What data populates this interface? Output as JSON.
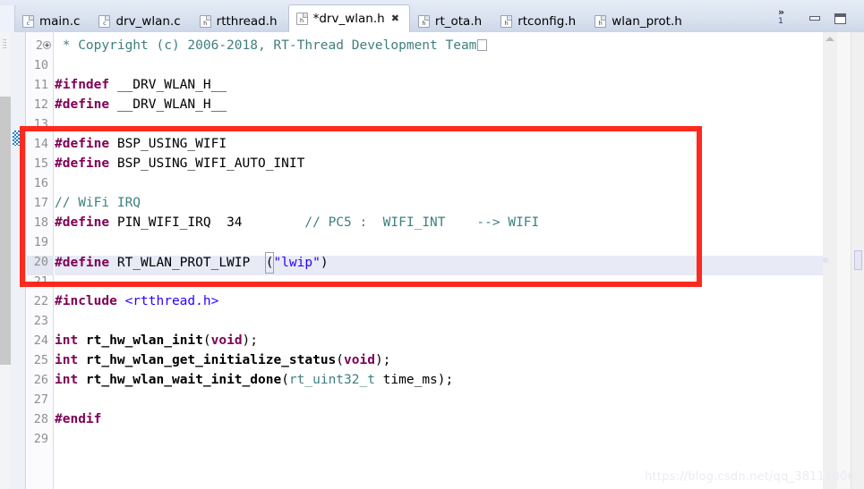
{
  "window": {
    "minimize_label": "Minimize",
    "maximize_label": "Maximize",
    "overflow_chevron": "»",
    "overflow_count": "1"
  },
  "tabs": [
    {
      "label": "main.c",
      "ext": "c",
      "active": false,
      "dirty": false
    },
    {
      "label": "drv_wlan.c",
      "ext": "c",
      "active": false,
      "dirty": false
    },
    {
      "label": "rtthread.h",
      "ext": "h",
      "active": false,
      "dirty": false
    },
    {
      "label": "*drv_wlan.h",
      "ext": "h",
      "active": true,
      "dirty": true,
      "close_glyph": "✖"
    },
    {
      "label": "rt_ota.h",
      "ext": "h",
      "active": false,
      "dirty": false
    },
    {
      "label": "rtconfig.h",
      "ext": "h",
      "active": false,
      "dirty": false
    },
    {
      "label": "wlan_prot.h",
      "ext": "h",
      "active": false,
      "dirty": false
    }
  ],
  "editor": {
    "filename": "drv_wlan.h",
    "current_line": 20,
    "changed_line": 14,
    "folded_line": 2,
    "lines": [
      {
        "num": "2",
        "text": " * Copyright (c) 2006-2018, RT-Thread Development Team",
        "kind": "comment",
        "folded": true
      },
      {
        "num": "10",
        "text": "",
        "kind": "blank"
      },
      {
        "num": "11",
        "text": "#ifndef __DRV_WLAN_H__",
        "kind": "ifndef"
      },
      {
        "num": "12",
        "text": "#define __DRV_WLAN_H__",
        "kind": "define_plain"
      },
      {
        "num": "13",
        "text": "",
        "kind": "blank"
      },
      {
        "num": "14",
        "text": "#define BSP_USING_WIFI",
        "kind": "define_plain"
      },
      {
        "num": "15",
        "text": "#define BSP_USING_WIFI_AUTO_INIT",
        "kind": "define_plain"
      },
      {
        "num": "16",
        "text": "",
        "kind": "blank"
      },
      {
        "num": "17",
        "text": "// WiFi IRQ",
        "kind": "comment"
      },
      {
        "num": "18",
        "text": "#define PIN_WIFI_IRQ  34        // PC5 :  WIFI_INT    --> WIFI",
        "kind": "define_num_comment"
      },
      {
        "num": "19",
        "text": "",
        "kind": "blank"
      },
      {
        "num": "20",
        "text": "#define RT_WLAN_PROT_LWIP  (\"lwip\")",
        "kind": "define_string"
      },
      {
        "num": "21",
        "text": "",
        "kind": "blank"
      },
      {
        "num": "22",
        "text": "#include <rtthread.h>",
        "kind": "include"
      },
      {
        "num": "23",
        "text": "",
        "kind": "blank"
      },
      {
        "num": "24",
        "text": "int rt_hw_wlan_init(void);",
        "kind": "decl"
      },
      {
        "num": "25",
        "text": "int rt_hw_wlan_get_initialize_status(void);",
        "kind": "decl"
      },
      {
        "num": "26",
        "text": "int rt_hw_wlan_wait_init_done(rt_uint32_t time_ms);",
        "kind": "decl"
      },
      {
        "num": "27",
        "text": "",
        "kind": "blank"
      },
      {
        "num": "28",
        "text": "#endif",
        "kind": "endif"
      },
      {
        "num": "29",
        "text": "",
        "kind": "blank"
      }
    ],
    "tokens": {
      "line2_comment": " * Copyright (c) 2006-2018, RT-Thread Development Team",
      "line11_pre": "#ifndef",
      "line11_rest": " __DRV_WLAN_H__",
      "line12_pre": "#define",
      "line12_rest": " __DRV_WLAN_H__",
      "line14_pre": "#define",
      "line14_rest": " BSP_USING_WIFI",
      "line15_pre": "#define",
      "line15_rest": " BSP_USING_WIFI_AUTO_INIT",
      "line17_comment": "// WiFi IRQ",
      "line18_pre": "#define",
      "line18_name": " PIN_WIFI_IRQ  ",
      "line18_num": "34",
      "line18_gap": "        ",
      "line18_comment": "// PC5 :  WIFI_INT    --> WIFI",
      "line20_pre": "#define",
      "line20_name": " RT_WLAN_PROT_LWIP  ",
      "line20_paren_open": "(",
      "line20_string": "\"lwip\"",
      "line20_paren_close": ")",
      "line22_pre": "#include",
      "line22_header": " <rtthread.h>",
      "line24_kw": "int",
      "line24_fn": " rt_hw_wlan_init",
      "line24_open": "(",
      "line24_arg": "void",
      "line24_close": ");",
      "line25_kw": "int",
      "line25_fn": " rt_hw_wlan_get_initialize_status",
      "line25_open": "(",
      "line25_arg": "void",
      "line25_close": ");",
      "line26_kw": "int",
      "line26_fn": " rt_hw_wlan_wait_init_done",
      "line26_open": "(",
      "line26_type": "rt_uint32_t",
      "line26_param": " time_ms",
      "line26_close": ");",
      "line28_pre": "#endif"
    }
  },
  "annotation": {
    "type": "red-rectangle",
    "covers_lines": "13-21",
    "color": "#fc2a1f"
  },
  "watermark": {
    "text": "https://blog.csdn.net/qq_38113006"
  },
  "colors": {
    "preprocessor": "#7f0055",
    "comment": "#3f7f7f",
    "string": "#2a00ff",
    "plain": "#000000",
    "current_line_bg": "#e8eaf6",
    "tabbar_bg": "#dae2f0",
    "annotation_red": "#fc2a1f"
  }
}
